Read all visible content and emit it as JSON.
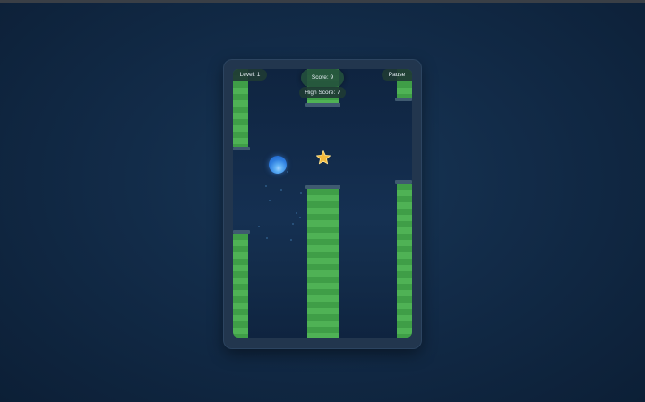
{
  "game": {
    "level_label": "Level: 1",
    "score_label": "Score: 9",
    "high_score_label": "High Score: 7",
    "pause_label": "Pause"
  },
  "colors": {
    "pipe_light": "#4fb255",
    "pipe_dark": "#3f9e47",
    "pipe_cap": "#3f5a70",
    "ball": "#2f7fe0",
    "star": "#f5b93a"
  },
  "icons": {
    "player": "blue-orb",
    "pickup": "star"
  }
}
